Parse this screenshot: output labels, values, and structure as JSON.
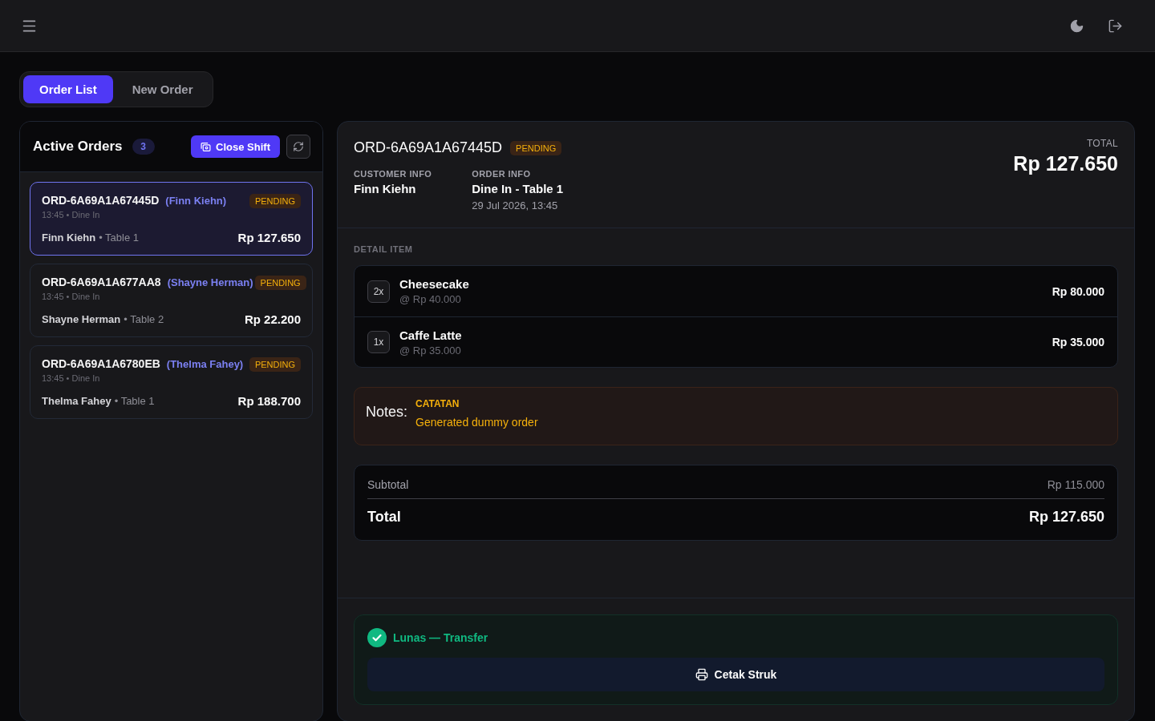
{
  "tabs": [
    {
      "label": "Order List",
      "selected": true
    },
    {
      "label": "New Order",
      "selected": false
    }
  ],
  "orders_panel": {
    "title": "Active Orders",
    "count": "3",
    "close_shift_button": "Close Shift"
  },
  "orders": [
    {
      "id": "ORD-6A69A1A67445D",
      "customer": "(Finn Kiehn)",
      "status": "PENDING",
      "meta": "13:45 • Dine In",
      "customer_name": "Finn Kiehn",
      "table": "• Table 1",
      "amount": "Rp 127.650",
      "selected": true
    },
    {
      "id": "ORD-6A69A1A677AA8",
      "customer": "(Shayne Herman)",
      "status": "PENDING",
      "meta": "13:45 • Dine In",
      "customer_name": "Shayne Herman",
      "table": "• Table 2",
      "amount": "Rp 22.200",
      "selected": false
    },
    {
      "id": "ORD-6A69A1A6780EB",
      "customer": "(Thelma Fahey)",
      "status": "PENDING",
      "meta": "13:45 • Dine In",
      "customer_name": "Thelma Fahey",
      "table": "• Table 1",
      "amount": "Rp 188.700",
      "selected": false
    }
  ],
  "order_detail": {
    "id": "ORD-6A69A1A67445D",
    "status": "PENDING",
    "total_label": "TOTAL",
    "total": "Rp 127.650",
    "customer_info": {
      "label": "CUSTOMER INFO",
      "name": "Finn Kiehn"
    },
    "order_info": {
      "label": "ORDER INFO",
      "type": "Dine In - Table 1",
      "date": "29 Jul 2026, 13:45"
    },
    "items_label": "DETAIL ITEM",
    "items": [
      {
        "qty": "2x",
        "name": "Cheesecake",
        "unit_price": "@ Rp 40.000",
        "amount": "Rp 80.000"
      },
      {
        "qty": "1x",
        "name": "Caffe Latte",
        "unit_price": "@ Rp 35.000",
        "amount": "Rp 35.000"
      }
    ],
    "notes": {
      "label": "Notes:",
      "title": "CATATAN",
      "text": "Generated dummy order"
    },
    "summary": {
      "subtotal_label": "Subtotal",
      "subtotal": "Rp 115.000",
      "total_label": "Total",
      "total": "Rp 127.650"
    },
    "payment": {
      "status": "Lunas — Transfer",
      "print_button": "Cetak Struk"
    }
  }
}
